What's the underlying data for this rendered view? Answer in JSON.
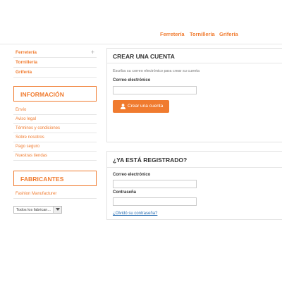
{
  "top_nav": {
    "items": [
      {
        "label": "Ferretería"
      },
      {
        "label": "Tornillería"
      },
      {
        "label": "Grifería"
      }
    ]
  },
  "sidebar": {
    "categories": [
      {
        "label": "Ferretería"
      },
      {
        "label": "Tornillería"
      },
      {
        "label": "Grifería"
      }
    ],
    "info_block": {
      "title": "INFORMACIÓN",
      "items": [
        {
          "label": "Envío"
        },
        {
          "label": "Aviso legal"
        },
        {
          "label": "Términos y condiciones"
        },
        {
          "label": "Sobre nosotros"
        },
        {
          "label": "Pago seguro"
        },
        {
          "label": "Nuestras tiendas"
        }
      ]
    },
    "manufacturers_block": {
      "title": "FABRICANTES",
      "items": [
        {
          "label": "Fashion Manufacturer"
        }
      ],
      "select_value": "Todos los fabrican..."
    }
  },
  "create_account": {
    "title": "CREAR UNA CUENTA",
    "intro": "Escriba su correo electrónico para crear su cuenta",
    "email_label": "Correo electrónico",
    "email_value": "",
    "button_label": "Crear una cuenta"
  },
  "login": {
    "title": "¿YA ESTÁ REGISTRADO?",
    "email_label": "Correo electrónico",
    "email_value": "",
    "password_label": "Contraseña",
    "password_value": "",
    "forgot_link": "¿Olvidó su contraseña?"
  },
  "colors": {
    "accent": "#f07b2f",
    "link": "#2a6fb3"
  },
  "icons": {
    "expand": "plus-icon",
    "user": "user-icon",
    "dropdown": "chevron-down-icon"
  }
}
